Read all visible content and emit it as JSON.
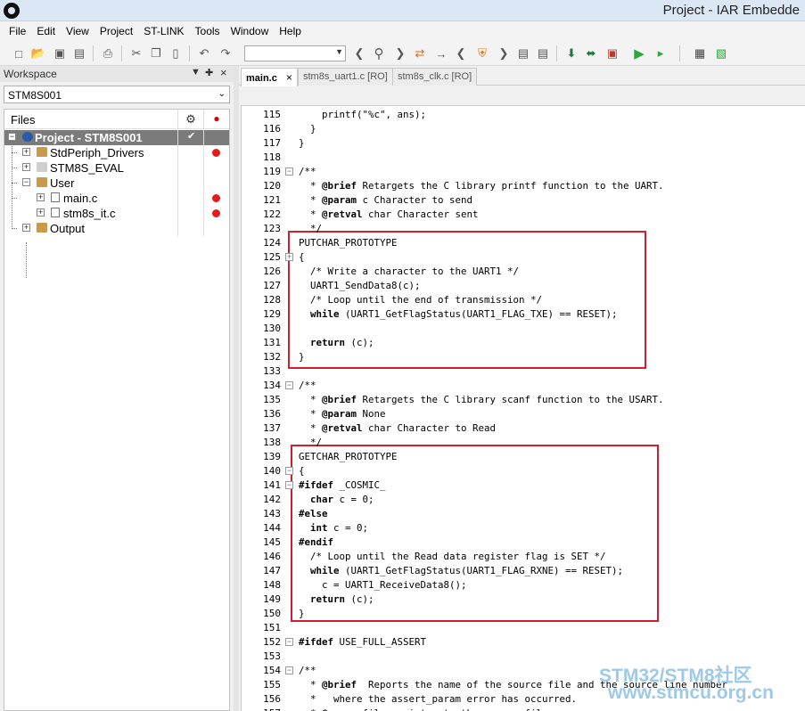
{
  "window": {
    "title": "Project - IAR Embedde"
  },
  "menu": [
    "File",
    "Edit",
    "View",
    "Project",
    "ST-LINK",
    "Tools",
    "Window",
    "Help"
  ],
  "toolbar": {
    "icons": [
      "new-file-icon",
      "open-icon",
      "save-icon",
      "save-all-icon",
      "print-icon",
      "cut-icon",
      "copy-icon",
      "paste-icon",
      "undo-icon",
      "redo-icon",
      "find-combo",
      "search-back-icon",
      "find-icon",
      "search-forward-icon",
      "replace-icon",
      "goto-icon",
      "nav-back-icon",
      "bookmark-icon",
      "nav-forward-icon",
      "file-prev-icon",
      "file-next-icon",
      "download-icon",
      "download-debug-icon",
      "make-icon",
      "debug-icon",
      "run-icon",
      "build-icon",
      "stop-build-icon"
    ]
  },
  "workspace": {
    "title": "Workspace",
    "pin": "↓",
    "pin2": "❂",
    "close": "×",
    "config": "STM8S001",
    "files_header": "Files",
    "settings_icon": "⚙",
    "status_icon": "●",
    "tree": [
      {
        "label": "Project - STM8S001",
        "check": "✔",
        "dot": false
      },
      {
        "label": "StdPeriph_Drivers",
        "dot": true
      },
      {
        "label": "STM8S_EVAL",
        "dot": false
      },
      {
        "label": "User",
        "dot": false
      },
      {
        "label": "main.c",
        "dot": true
      },
      {
        "label": "stm8s_it.c",
        "dot": true
      },
      {
        "label": "Output",
        "dot": false
      }
    ]
  },
  "tabs": [
    {
      "label": "main.c",
      "close": "×"
    },
    {
      "label": "stm8s_uart1.c [RO]"
    },
    {
      "label": "stm8s_clk.c [RO]"
    }
  ],
  "code": [
    {
      "n": "115",
      "t": "    printf(\"%c\", ans);"
    },
    {
      "n": "116",
      "t": "  }"
    },
    {
      "n": "117",
      "t": "}"
    },
    {
      "n": "118",
      "t": ""
    },
    {
      "n": "119",
      "t": "/**"
    },
    {
      "n": "120",
      "t": "  * @brief Retargets the C library printf function to the UART."
    },
    {
      "n": "121",
      "t": "  * @param c Character to send"
    },
    {
      "n": "122",
      "t": "  * @retval char Character sent"
    },
    {
      "n": "123",
      "t": "  */"
    },
    {
      "n": "124",
      "t": "PUTCHAR_PROTOTYPE"
    },
    {
      "n": "125",
      "t": "{"
    },
    {
      "n": "126",
      "t": "  /* Write a character to the UART1 */"
    },
    {
      "n": "127",
      "t": "  UART1_SendData8(c);"
    },
    {
      "n": "128",
      "t": "  /* Loop until the end of transmission */"
    },
    {
      "n": "129",
      "t": "  while (UART1_GetFlagStatus(UART1_FLAG_TXE) == RESET);"
    },
    {
      "n": "130",
      "t": ""
    },
    {
      "n": "131",
      "t": "  return (c);"
    },
    {
      "n": "132",
      "t": "}"
    },
    {
      "n": "133",
      "t": ""
    },
    {
      "n": "134",
      "t": "/**"
    },
    {
      "n": "135",
      "t": "  * @brief Retargets the C library scanf function to the USART."
    },
    {
      "n": "136",
      "t": "  * @param None"
    },
    {
      "n": "137",
      "t": "  * @retval char Character to Read"
    },
    {
      "n": "138",
      "t": "  */"
    },
    {
      "n": "139",
      "t": "GETCHAR_PROTOTYPE"
    },
    {
      "n": "140",
      "t": "{"
    },
    {
      "n": "141",
      "t": "#ifdef _COSMIC_"
    },
    {
      "n": "142",
      "t": "  char c = 0;"
    },
    {
      "n": "143",
      "t": "#else"
    },
    {
      "n": "144",
      "t": "  int c = 0;"
    },
    {
      "n": "145",
      "t": "#endif"
    },
    {
      "n": "146",
      "t": "  /* Loop until the Read data register flag is SET */"
    },
    {
      "n": "147",
      "t": "  while (UART1_GetFlagStatus(UART1_FLAG_RXNE) == RESET);"
    },
    {
      "n": "148",
      "t": "    c = UART1_ReceiveData8();"
    },
    {
      "n": "149",
      "t": "  return (c);"
    },
    {
      "n": "150",
      "t": "}"
    },
    {
      "n": "151",
      "t": ""
    },
    {
      "n": "152",
      "t": "#ifdef USE_FULL_ASSERT"
    },
    {
      "n": "153",
      "t": ""
    },
    {
      "n": "154",
      "t": "/**"
    },
    {
      "n": "155",
      "t": "  * @brief  Reports the name of the source file and the source line number"
    },
    {
      "n": "156",
      "t": "  *   where the assert_param error has occurred."
    },
    {
      "n": "157",
      "t": "  * @param file: pointer to the source file name"
    }
  ],
  "watermark": {
    "line1": "STM32/STM8社区",
    "line2": "www.stmcu.org.cn"
  },
  "colors": {
    "highlight": "#d41c2c",
    "selected_row": "#7b7b7b",
    "status_dot": "#e21b1b"
  }
}
